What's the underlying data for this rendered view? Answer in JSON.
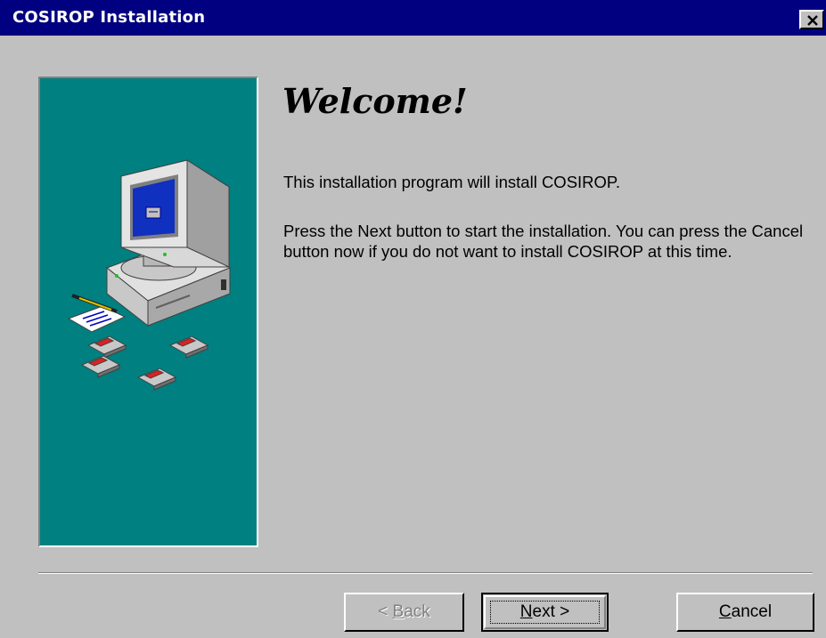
{
  "window": {
    "title": "COSIROP Installation",
    "close_symbol": "✕"
  },
  "content": {
    "heading": "Welcome!",
    "paragraph1": "This installation program will install COSIROP.",
    "paragraph2": "Press the Next button to start the installation. You can press the Cancel button now if you do not want to install COSIROP at this time."
  },
  "buttons": {
    "back": {
      "pre": "< ",
      "mnemonic": "B",
      "rest": "ack",
      "enabled": false
    },
    "next": {
      "pre": "",
      "mnemonic": "N",
      "rest": "ext >",
      "default": true
    },
    "cancel": {
      "pre": "",
      "mnemonic": "C",
      "rest": "ancel"
    }
  },
  "graphic": {
    "icon": "computer-with-floppy-disks-illustration",
    "panel_color": "#008080"
  },
  "colors": {
    "titlebar": "#000080",
    "dialog_face": "#c0c0c0"
  }
}
